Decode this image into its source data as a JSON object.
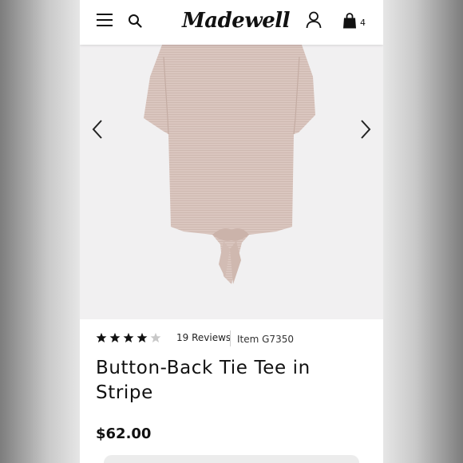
{
  "header": {
    "brand": "Madewell",
    "bag_count": "4",
    "icons": [
      "menu-icon",
      "search-icon",
      "account-icon",
      "shopping-bag-icon"
    ]
  },
  "gallery": {
    "icons": [
      "chevron-left-icon",
      "chevron-right-icon"
    ],
    "background": "#f1f0f1",
    "garment_color": "#d8c4bd"
  },
  "product": {
    "rating": 4,
    "rating_max": 5,
    "reviews": "19 Reviews",
    "item_number": "Item G7350",
    "title": "Button-Back Tie Tee in Stripe",
    "price": "$62.00"
  },
  "colors": {
    "text": "#111111",
    "star_filled": "#111111",
    "star_empty": "#c8c8c8"
  }
}
